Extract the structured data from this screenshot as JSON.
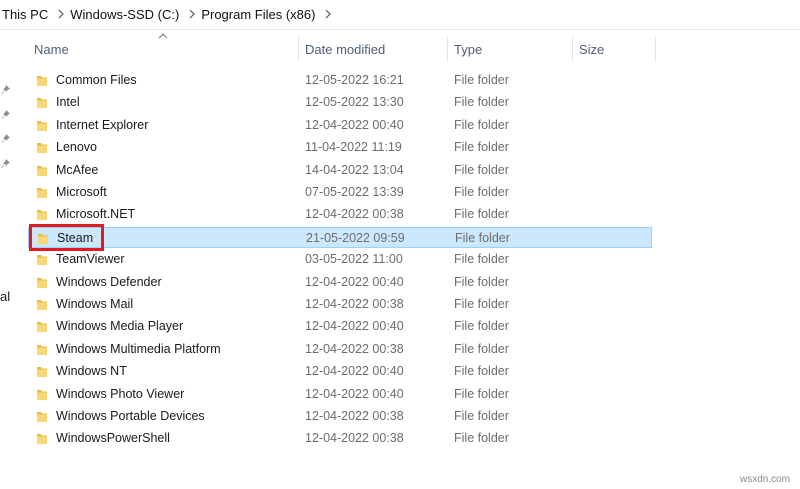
{
  "breadcrumb": {
    "items": [
      "This PC",
      "Windows-SSD (C:)",
      "Program Files (x86)"
    ]
  },
  "nav_pane": {
    "partial_label": "al"
  },
  "columns": {
    "name": "Name",
    "date_modified": "Date modified",
    "type": "Type",
    "size": "Size"
  },
  "rows": [
    {
      "name": "Common Files",
      "date": "12-05-2022 16:21",
      "type": "File folder",
      "size": ""
    },
    {
      "name": "Intel",
      "date": "12-05-2022 13:30",
      "type": "File folder",
      "size": ""
    },
    {
      "name": "Internet Explorer",
      "date": "12-04-2022 00:40",
      "type": "File folder",
      "size": ""
    },
    {
      "name": "Lenovo",
      "date": "11-04-2022 11:19",
      "type": "File folder",
      "size": ""
    },
    {
      "name": "McAfee",
      "date": "14-04-2022 13:04",
      "type": "File folder",
      "size": ""
    },
    {
      "name": "Microsoft",
      "date": "07-05-2022 13:39",
      "type": "File folder",
      "size": ""
    },
    {
      "name": "Microsoft.NET",
      "date": "12-04-2022 00:38",
      "type": "File folder",
      "size": ""
    },
    {
      "name": "Steam",
      "date": "21-05-2022 09:59",
      "type": "File folder",
      "size": "",
      "selected": true
    },
    {
      "name": "TeamViewer",
      "date": "03-05-2022 11:00",
      "type": "File folder",
      "size": ""
    },
    {
      "name": "Windows Defender",
      "date": "12-04-2022 00:40",
      "type": "File folder",
      "size": ""
    },
    {
      "name": "Windows Mail",
      "date": "12-04-2022 00:38",
      "type": "File folder",
      "size": ""
    },
    {
      "name": "Windows Media Player",
      "date": "12-04-2022 00:40",
      "type": "File folder",
      "size": ""
    },
    {
      "name": "Windows Multimedia Platform",
      "date": "12-04-2022 00:38",
      "type": "File folder",
      "size": ""
    },
    {
      "name": "Windows NT",
      "date": "12-04-2022 00:40",
      "type": "File folder",
      "size": ""
    },
    {
      "name": "Windows Photo Viewer",
      "date": "12-04-2022 00:40",
      "type": "File folder",
      "size": ""
    },
    {
      "name": "Windows Portable Devices",
      "date": "12-04-2022 00:38",
      "type": "File folder",
      "size": ""
    },
    {
      "name": "WindowsPowerShell",
      "date": "12-04-2022 00:38",
      "type": "File folder",
      "size": ""
    }
  ],
  "colors": {
    "selection_bg": "#cce8ff",
    "selection_border": "#99d1ff",
    "highlight_border": "#e01b24",
    "folder_yellow": "#f8d775",
    "header_text": "#4c607a"
  },
  "watermark": "wsxdn.com"
}
